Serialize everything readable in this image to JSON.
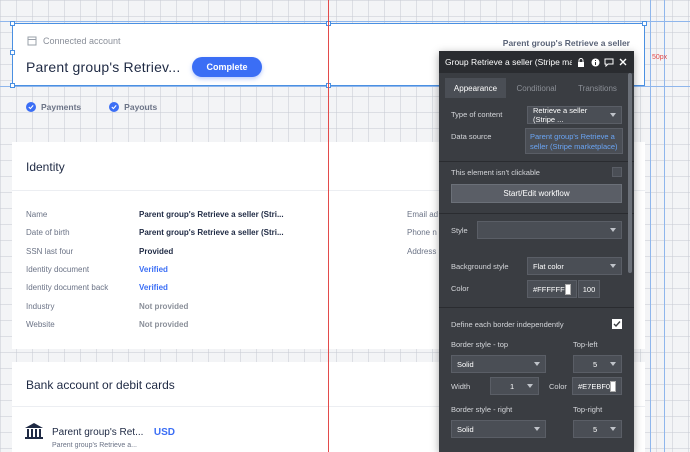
{
  "header": {
    "connected_label": "Connected account",
    "title": "Parent group's Retriev...",
    "complete_label": "Complete",
    "parent_right": "Parent group's Retrieve a seller"
  },
  "checks": [
    {
      "label": "Payments"
    },
    {
      "label": "Payouts"
    }
  ],
  "identity": {
    "title": "Identity",
    "fields": [
      {
        "label": "Name",
        "value": "Parent group's Retrieve a seller (Stri..."
      },
      {
        "label": "Date of birth",
        "value": "Parent group's Retrieve a seller (Stri..."
      },
      {
        "label": "SSN last four",
        "value": "Provided"
      },
      {
        "label": "Identity document",
        "value": "Verified"
      },
      {
        "label": "Identity document back",
        "value": "Verified"
      },
      {
        "label": "Industry",
        "value": "Not provided"
      },
      {
        "label": "Website",
        "value": "Not provided"
      }
    ],
    "right_fields": [
      "Email ad",
      "Phone n",
      "Address"
    ]
  },
  "bank": {
    "title": "Bank account or debit cards",
    "name": "Parent group's Ret...",
    "sub": "Parent group's Retrieve a...",
    "currency": "USD"
  },
  "guides": {
    "px_label": "50px"
  },
  "panel": {
    "title": "Group Retrieve a seller (Stripe ma",
    "tabs": [
      "Appearance",
      "Conditional",
      "Transitions"
    ],
    "type_label": "Type of content",
    "type_value": "Retrieve a seller (Stripe ...",
    "source_label": "Data source",
    "source_value": "Parent group's Retrieve a seller (Stripe marketplace)",
    "not_clickable": "This element isn't clickable",
    "workflow_btn": "Start/Edit workflow",
    "style_label": "Style",
    "style_value": "",
    "bg_label": "Background style",
    "bg_value": "Flat color",
    "color_label": "Color",
    "color_hex": "#FFFFFF",
    "color_opacity": "100",
    "each_border": "Define each border independently",
    "border_top_label": "Border style - top",
    "border_top_value": "Solid",
    "top_left_label": "Top-left",
    "top_left_value": "5",
    "width_label": "Width",
    "width_value": "1",
    "color2_label": "Color",
    "color2_hex": "#E7EBF0",
    "border_right_label": "Border style - right",
    "border_right_value": "Solid",
    "top_right_label": "Top-right",
    "top_right_value": "5",
    "accent": "#3b6ef5"
  }
}
